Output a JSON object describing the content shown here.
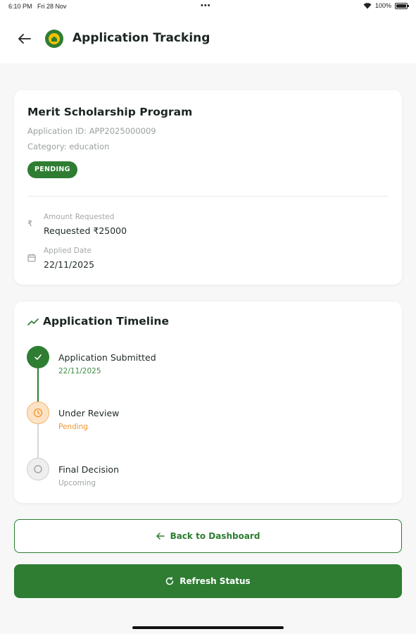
{
  "status_bar": {
    "time": "6:10 PM",
    "date": "Fri 28 Nov",
    "dots": "•••",
    "battery": "100%"
  },
  "header": {
    "title": "Application Tracking"
  },
  "application": {
    "program_title": "Merit Scholarship Program",
    "application_id": "Application ID: APP2025000009",
    "category": "Category: education",
    "status_badge": "PENDING",
    "amount": {
      "label": "Amount Requested",
      "value": "Requested ₹25000",
      "icon": "₹"
    },
    "applied": {
      "label": "Applied Date",
      "value": "22/11/2025"
    }
  },
  "timeline": {
    "title": "Application Timeline",
    "steps": [
      {
        "title": "Application Submitted",
        "sub": "22/11/2025",
        "state": "done"
      },
      {
        "title": "Under Review",
        "sub": "Pending",
        "state": "review"
      },
      {
        "title": "Final Decision",
        "sub": "Upcoming",
        "state": "upcoming"
      }
    ]
  },
  "buttons": {
    "back": "Back to Dashboard",
    "refresh": "Refresh Status"
  },
  "colors": {
    "primary": "#2e7d32",
    "pending_orange": "#f0942e",
    "background": "#f6f7f6"
  }
}
